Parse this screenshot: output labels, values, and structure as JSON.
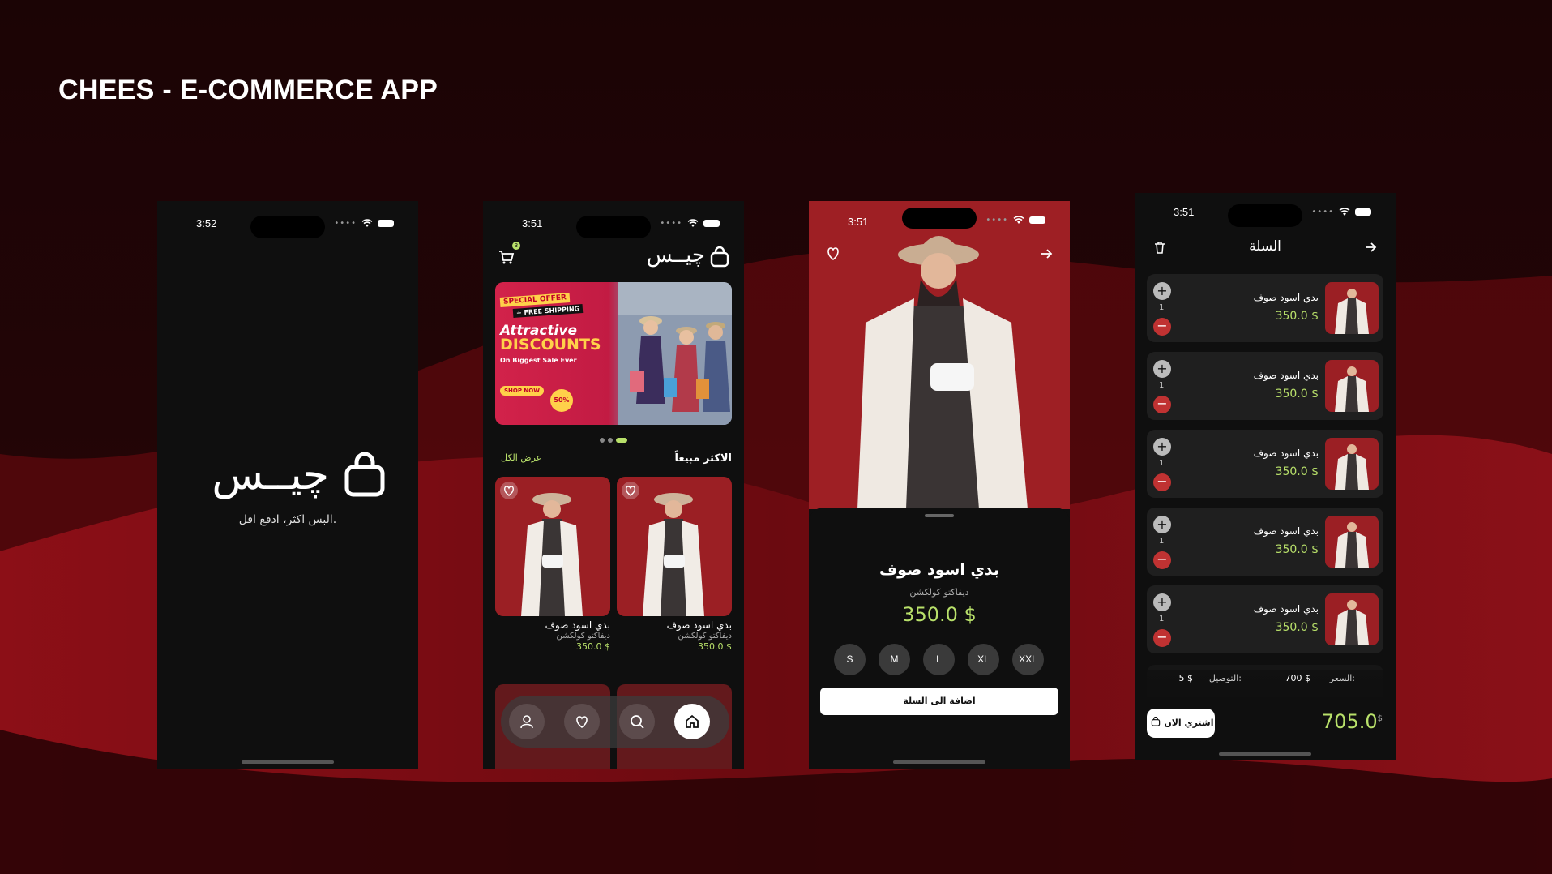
{
  "title": "CHEES - E-COMMERCE APP",
  "colors": {
    "accent": "#b8e06a",
    "brand_red": "#9e1f24",
    "dark": "#0f0f0f"
  },
  "screen1": {
    "time": "3:52",
    "logo_text": "چيــس",
    "tagline": "البس اكثر، ادفع اقل."
  },
  "screen2": {
    "time": "3:51",
    "cart_count": "3",
    "brand": "چيــس",
    "banner": {
      "special_offer": "SPECIAL OFFER",
      "free_shipping": "+ FREE SHIPPING",
      "attractive": "Attractive",
      "discounts": "DISCOUNTS",
      "subtitle": "On Biggest Sale Ever",
      "shop_now": "SHOP NOW",
      "discount_badge": "50%"
    },
    "section_title": "الاكثر مبيعاً",
    "see_all": "عرض الكل",
    "products": [
      {
        "name": "بدي اسود صوف",
        "brand": "ديفاكتو كولكشن",
        "price": "350.0 $"
      },
      {
        "name": "بدي اسود صوف",
        "brand": "ديفاكتو كولكشن",
        "price": "350.0 $"
      }
    ],
    "nav": [
      "user-icon",
      "heart-icon",
      "search-icon",
      "home-icon"
    ]
  },
  "screen3": {
    "time": "3:51",
    "product_name": "بدي اسود صوف",
    "brand": "ديفاكتو كولكشن",
    "price": "350.0 $",
    "sizes": [
      "S",
      "M",
      "L",
      "XL",
      "XXL"
    ],
    "add_to_cart": "اضافة الى السلة"
  },
  "screen4": {
    "time": "3:51",
    "title": "السلة",
    "items": [
      {
        "name": "بدي اسود صوف",
        "price": "350.0 $",
        "qty": "1"
      },
      {
        "name": "بدي اسود صوف",
        "price": "350.0 $",
        "qty": "1"
      },
      {
        "name": "بدي اسود صوف",
        "price": "350.0 $",
        "qty": "1"
      },
      {
        "name": "بدي اسود صوف",
        "price": "350.0 $",
        "qty": "1"
      },
      {
        "name": "بدي اسود صوف",
        "price": "350.0 $",
        "qty": "1"
      }
    ],
    "price_label": "السعر:",
    "price_value": "700 $",
    "delivery_label": "التوصيل:",
    "delivery_value": "5 $",
    "buy_now": "اشتري الان",
    "total": "705.0",
    "currency": "$"
  }
}
